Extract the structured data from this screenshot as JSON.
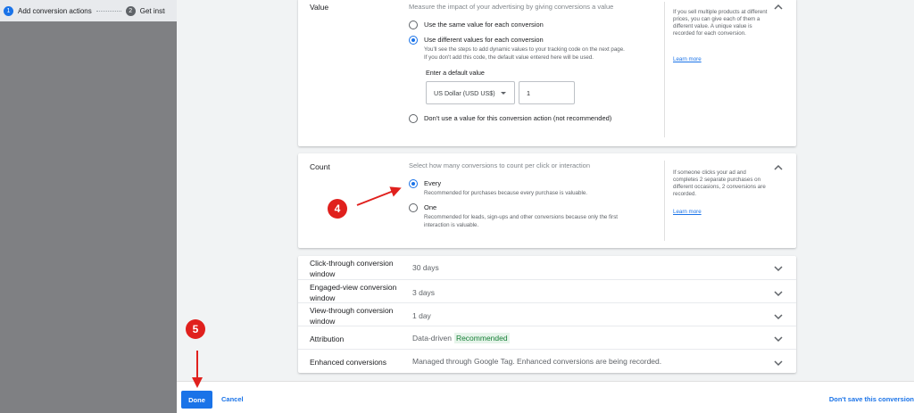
{
  "stepper": {
    "steps": [
      {
        "number": "1",
        "label": "Add conversion actions"
      },
      {
        "number": "2",
        "label": "Get instru"
      }
    ]
  },
  "value_section": {
    "title": "Value",
    "description": "Measure the impact of your advertising by giving conversions a value",
    "options": [
      {
        "label": "Use the same value for each conversion",
        "selected": false
      },
      {
        "label": "Use different values for each conversion",
        "selected": true,
        "sub_line1": "You'll see the steps to add dynamic values to your tracking code on the next page.",
        "sub_line2": "If you don't add this code, the default value entered here will be used."
      },
      {
        "label": "Don't use a value for this conversion action (not recommended)",
        "selected": false
      }
    ],
    "default_value_label": "Enter a default value",
    "currency": "US Dollar (USD US$)",
    "amount": "1",
    "help_text": "If you sell multiple products at different prices, you can give each of them a different value. A unique value is recorded for each conversion.",
    "learn_more": "Learn more"
  },
  "count_section": {
    "title": "Count",
    "description": "Select how many conversions to count per click or interaction",
    "options": [
      {
        "label": "Every",
        "selected": true,
        "sub_line1": "Recommended for purchases because every purchase is valuable.",
        "sub_line2": ""
      },
      {
        "label": "One",
        "selected": false,
        "sub_line1": "Recommended for leads, sign-ups and other conversions because only the first",
        "sub_line2": "interaction is valuable."
      }
    ],
    "help_text": "If someone clicks your ad and completes 2 separate purchases on different occasions, 2 conversions are recorded.",
    "learn_more": "Learn more"
  },
  "settings": [
    {
      "title": "Click-through conversion window",
      "value": "30 days",
      "badge": ""
    },
    {
      "title": "Engaged-view conversion window",
      "value": "3 days",
      "badge": ""
    },
    {
      "title": "View-through conversion window",
      "value": "1 day",
      "badge": ""
    },
    {
      "title": "Attribution",
      "value": "Data-driven",
      "badge": "Recommended"
    },
    {
      "title": "Enhanced conversions",
      "value": "Managed through Google Tag. Enhanced conversions are being recorded.",
      "badge": ""
    }
  ],
  "footer": {
    "done_label": "Done",
    "cancel_label": "Cancel",
    "dont_save_label": "Don't save this conversion"
  },
  "annotations": {
    "step4": "4",
    "step5": "5"
  },
  "colors": {
    "accent": "#1a73e8",
    "annotation": "#e0201d",
    "badge_bg": "#e6f4ea",
    "badge_text": "#188038"
  }
}
